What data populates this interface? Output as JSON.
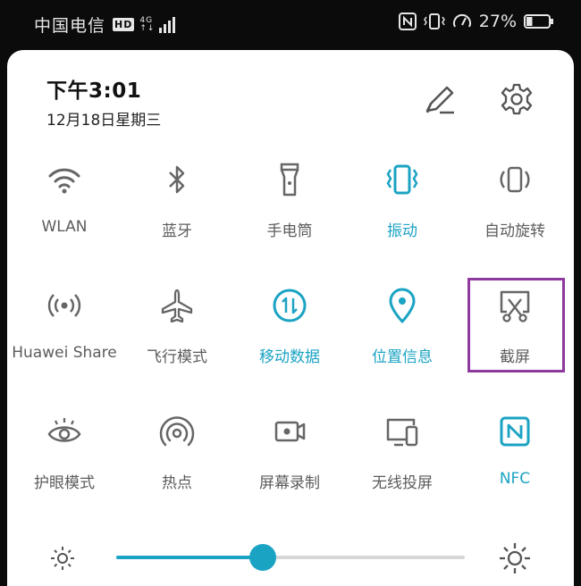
{
  "statusbar": {
    "carrier": "中国电信",
    "hd_badge": "HD",
    "net_type_top": "4G",
    "net_type_bottom": "↑↓",
    "battery_text": "27%",
    "battery_level": 0.27
  },
  "header": {
    "time": "下午3:01",
    "date": "12月18日星期三"
  },
  "colors": {
    "accent": "#1ba3c3",
    "inactive": "#5c5c5c",
    "highlight": "#8d3a9c"
  },
  "tiles": [
    {
      "label": "WLAN",
      "icon": "wifi-icon",
      "active": false
    },
    {
      "label": "蓝牙",
      "icon": "bluetooth-icon",
      "active": false
    },
    {
      "label": "手电筒",
      "icon": "flashlight-icon",
      "active": false
    },
    {
      "label": "振动",
      "icon": "vibrate-icon",
      "active": true
    },
    {
      "label": "自动旋转",
      "icon": "auto-rotate-icon",
      "active": false
    },
    {
      "label": "Huawei Share",
      "icon": "huawei-share-icon",
      "active": false
    },
    {
      "label": "飞行模式",
      "icon": "airplane-icon",
      "active": false
    },
    {
      "label": "移动数据",
      "icon": "mobile-data-icon",
      "active": true
    },
    {
      "label": "位置信息",
      "icon": "location-icon",
      "active": true
    },
    {
      "label": "截屏",
      "icon": "screenshot-icon",
      "active": false
    },
    {
      "label": "护眼模式",
      "icon": "eye-comfort-icon",
      "active": false
    },
    {
      "label": "热点",
      "icon": "hotspot-icon",
      "active": false
    },
    {
      "label": "屏幕录制",
      "icon": "screen-record-icon",
      "active": false
    },
    {
      "label": "无线投屏",
      "icon": "wireless-projection-icon",
      "active": false
    },
    {
      "label": "NFC",
      "icon": "nfc-icon",
      "active": true
    }
  ],
  "brightness": {
    "level": 0.42
  }
}
